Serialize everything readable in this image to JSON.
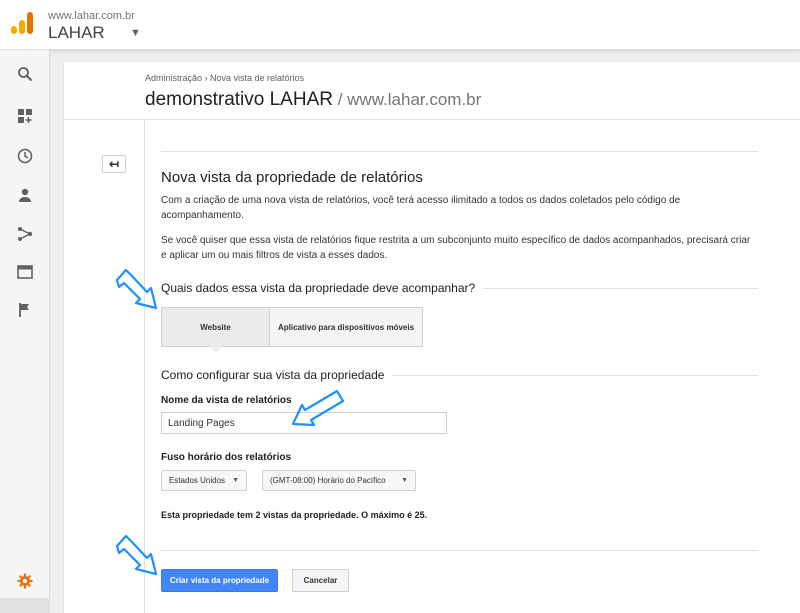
{
  "account": {
    "domain": "www.lahar.com.br",
    "name": "LAHAR"
  },
  "nav_icons": [
    "search-icon",
    "dashboard-icon",
    "clock-icon",
    "person-icon",
    "acquisition-icon",
    "behavior-icon",
    "flag-icon",
    "settings-gear-icon"
  ],
  "header": {
    "breadcrumb": "Administração › Nova vista de relatórios",
    "title": "demonstrativo LAHAR",
    "subtitle": " / www.lahar.com.br"
  },
  "form": {
    "section_title": "Nova vista da propriedade de relatórios",
    "paragraph_1": "Com a criação de uma nova vista de relatórios, você terá acesso ilimitado a todos os dados coletados pelo código de acompanhamento.",
    "paragraph_2": "Se você quiser que essa vista de relatórios fique restrita a um subconjunto muito específico de dados acompanhados, precisará criar e aplicar um ou mais filtros de vista a esses dados.",
    "question": "Quais dados essa vista da propriedade deve acompanhar?",
    "options": {
      "selected": "Website",
      "other": "Aplicativo para dispositivos móveis"
    },
    "config_title": "Como configurar sua vista da propriedade",
    "name_label": "Nome da vista de relatórios",
    "name_value": "Landing Pages",
    "timezone_label": "Fuso horário dos relatórios",
    "country": "Estados Unidos",
    "timezone": "(GMT-08:00) Horário do Pacífico",
    "limit_text": "Esta propriedade tem 2 vistas da propriedade. O máximo é 25.",
    "create_button": "Criar vista da propriedade",
    "cancel_button": "Cancelar"
  },
  "colors": {
    "primary_button": "#4285f4",
    "annotation_arrow": "#1e90ff",
    "settings_icon": "#e8710a",
    "logo_orange": "#f9ab00"
  }
}
